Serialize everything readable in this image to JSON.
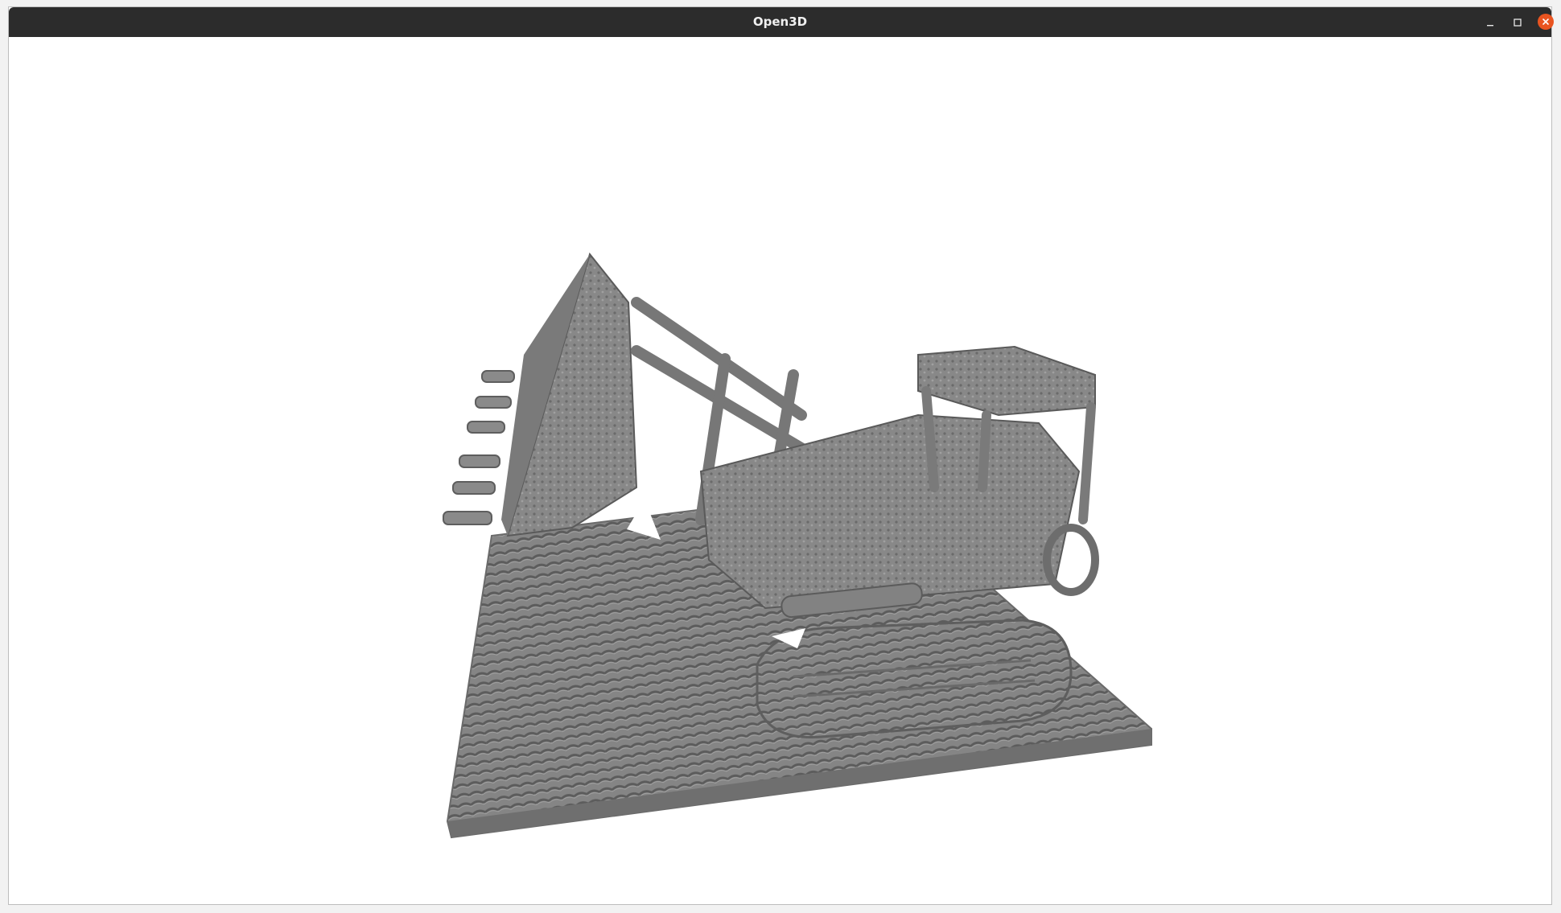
{
  "window": {
    "title": "Open3D",
    "controls": {
      "minimize": "minimize-icon",
      "maximize": "maximize-icon",
      "close": "close-icon"
    },
    "close_color": "#e95420",
    "titlebar_color": "#2c2c2c"
  },
  "viewport": {
    "background": "#ffffff",
    "mesh_color": "#8a8a8a",
    "content": "bulldozer-mesh"
  }
}
